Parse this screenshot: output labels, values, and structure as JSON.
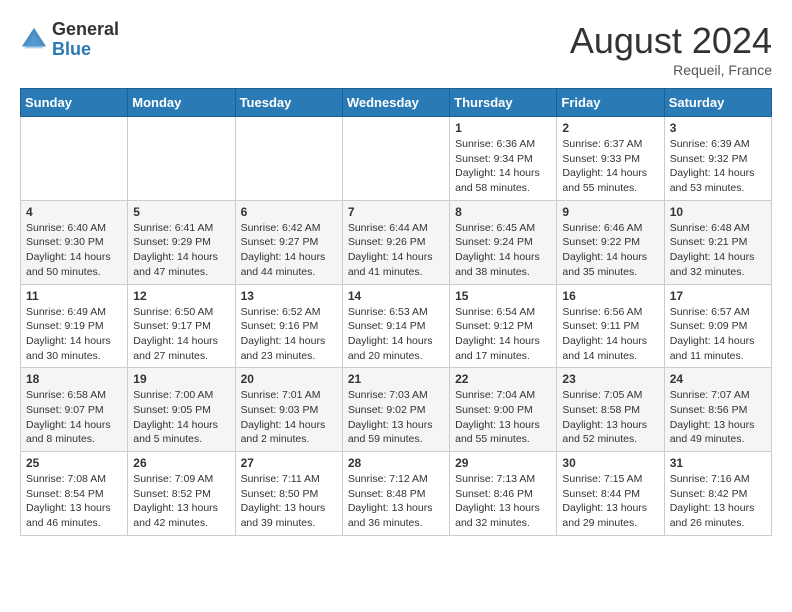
{
  "header": {
    "logo_general": "General",
    "logo_blue": "Blue",
    "month_title": "August 2024",
    "location": "Requeil, France"
  },
  "days_of_week": [
    "Sunday",
    "Monday",
    "Tuesday",
    "Wednesday",
    "Thursday",
    "Friday",
    "Saturday"
  ],
  "weeks": [
    [
      {
        "day": "",
        "info": ""
      },
      {
        "day": "",
        "info": ""
      },
      {
        "day": "",
        "info": ""
      },
      {
        "day": "",
        "info": ""
      },
      {
        "day": "1",
        "info": "Sunrise: 6:36 AM\nSunset: 9:34 PM\nDaylight: 14 hours\nand 58 minutes."
      },
      {
        "day": "2",
        "info": "Sunrise: 6:37 AM\nSunset: 9:33 PM\nDaylight: 14 hours\nand 55 minutes."
      },
      {
        "day": "3",
        "info": "Sunrise: 6:39 AM\nSunset: 9:32 PM\nDaylight: 14 hours\nand 53 minutes."
      }
    ],
    [
      {
        "day": "4",
        "info": "Sunrise: 6:40 AM\nSunset: 9:30 PM\nDaylight: 14 hours\nand 50 minutes."
      },
      {
        "day": "5",
        "info": "Sunrise: 6:41 AM\nSunset: 9:29 PM\nDaylight: 14 hours\nand 47 minutes."
      },
      {
        "day": "6",
        "info": "Sunrise: 6:42 AM\nSunset: 9:27 PM\nDaylight: 14 hours\nand 44 minutes."
      },
      {
        "day": "7",
        "info": "Sunrise: 6:44 AM\nSunset: 9:26 PM\nDaylight: 14 hours\nand 41 minutes."
      },
      {
        "day": "8",
        "info": "Sunrise: 6:45 AM\nSunset: 9:24 PM\nDaylight: 14 hours\nand 38 minutes."
      },
      {
        "day": "9",
        "info": "Sunrise: 6:46 AM\nSunset: 9:22 PM\nDaylight: 14 hours\nand 35 minutes."
      },
      {
        "day": "10",
        "info": "Sunrise: 6:48 AM\nSunset: 9:21 PM\nDaylight: 14 hours\nand 32 minutes."
      }
    ],
    [
      {
        "day": "11",
        "info": "Sunrise: 6:49 AM\nSunset: 9:19 PM\nDaylight: 14 hours\nand 30 minutes."
      },
      {
        "day": "12",
        "info": "Sunrise: 6:50 AM\nSunset: 9:17 PM\nDaylight: 14 hours\nand 27 minutes."
      },
      {
        "day": "13",
        "info": "Sunrise: 6:52 AM\nSunset: 9:16 PM\nDaylight: 14 hours\nand 23 minutes."
      },
      {
        "day": "14",
        "info": "Sunrise: 6:53 AM\nSunset: 9:14 PM\nDaylight: 14 hours\nand 20 minutes."
      },
      {
        "day": "15",
        "info": "Sunrise: 6:54 AM\nSunset: 9:12 PM\nDaylight: 14 hours\nand 17 minutes."
      },
      {
        "day": "16",
        "info": "Sunrise: 6:56 AM\nSunset: 9:11 PM\nDaylight: 14 hours\nand 14 minutes."
      },
      {
        "day": "17",
        "info": "Sunrise: 6:57 AM\nSunset: 9:09 PM\nDaylight: 14 hours\nand 11 minutes."
      }
    ],
    [
      {
        "day": "18",
        "info": "Sunrise: 6:58 AM\nSunset: 9:07 PM\nDaylight: 14 hours\nand 8 minutes."
      },
      {
        "day": "19",
        "info": "Sunrise: 7:00 AM\nSunset: 9:05 PM\nDaylight: 14 hours\nand 5 minutes."
      },
      {
        "day": "20",
        "info": "Sunrise: 7:01 AM\nSunset: 9:03 PM\nDaylight: 14 hours\nand 2 minutes."
      },
      {
        "day": "21",
        "info": "Sunrise: 7:03 AM\nSunset: 9:02 PM\nDaylight: 13 hours\nand 59 minutes."
      },
      {
        "day": "22",
        "info": "Sunrise: 7:04 AM\nSunset: 9:00 PM\nDaylight: 13 hours\nand 55 minutes."
      },
      {
        "day": "23",
        "info": "Sunrise: 7:05 AM\nSunset: 8:58 PM\nDaylight: 13 hours\nand 52 minutes."
      },
      {
        "day": "24",
        "info": "Sunrise: 7:07 AM\nSunset: 8:56 PM\nDaylight: 13 hours\nand 49 minutes."
      }
    ],
    [
      {
        "day": "25",
        "info": "Sunrise: 7:08 AM\nSunset: 8:54 PM\nDaylight: 13 hours\nand 46 minutes."
      },
      {
        "day": "26",
        "info": "Sunrise: 7:09 AM\nSunset: 8:52 PM\nDaylight: 13 hours\nand 42 minutes."
      },
      {
        "day": "27",
        "info": "Sunrise: 7:11 AM\nSunset: 8:50 PM\nDaylight: 13 hours\nand 39 minutes."
      },
      {
        "day": "28",
        "info": "Sunrise: 7:12 AM\nSunset: 8:48 PM\nDaylight: 13 hours\nand 36 minutes."
      },
      {
        "day": "29",
        "info": "Sunrise: 7:13 AM\nSunset: 8:46 PM\nDaylight: 13 hours\nand 32 minutes."
      },
      {
        "day": "30",
        "info": "Sunrise: 7:15 AM\nSunset: 8:44 PM\nDaylight: 13 hours\nand 29 minutes."
      },
      {
        "day": "31",
        "info": "Sunrise: 7:16 AM\nSunset: 8:42 PM\nDaylight: 13 hours\nand 26 minutes."
      }
    ]
  ]
}
